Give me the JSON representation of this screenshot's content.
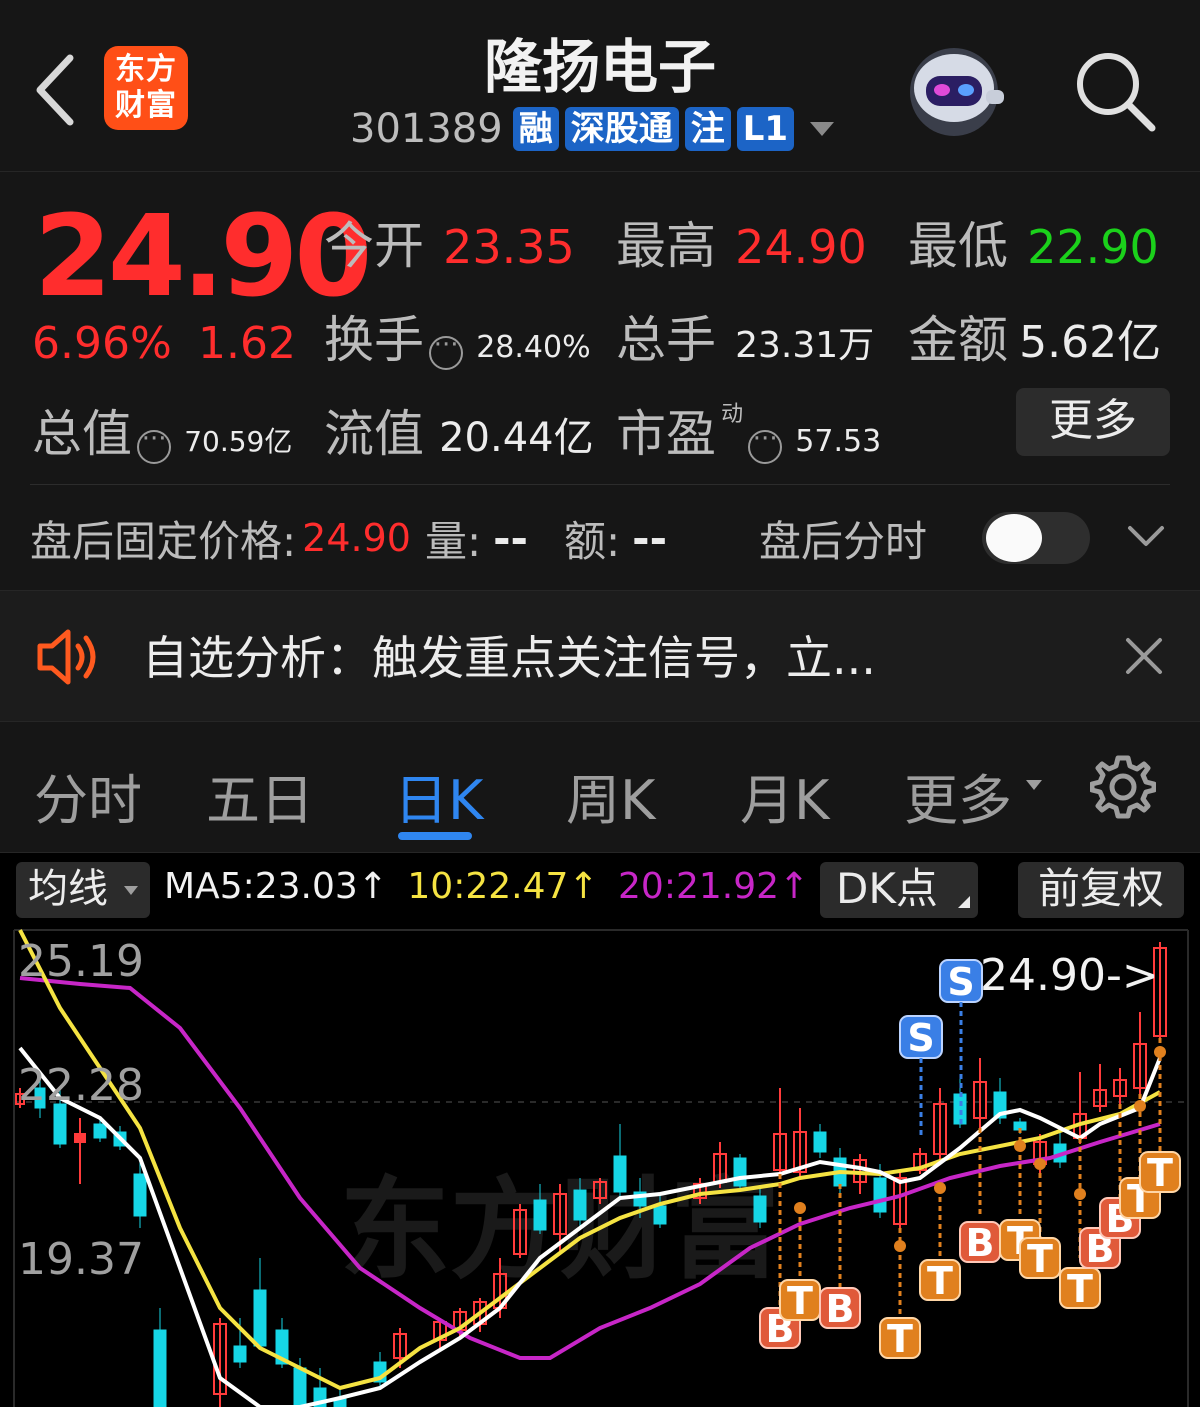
{
  "header": {
    "logo_line1": "东方",
    "logo_line2": "财富",
    "title": "隆扬电子",
    "code": "301389",
    "tags": [
      "融",
      "深股通",
      "注",
      "L1"
    ]
  },
  "quote": {
    "price": "24.90",
    "change_pct": "6.96%",
    "change_amt": "1.62",
    "open_label": "今开",
    "open": "23.35",
    "high_label": "最高",
    "high": "24.90",
    "low_label": "最低",
    "low": "22.90",
    "turnover_label": "换手",
    "turnover": "28.40%",
    "volume_label": "总手",
    "volume": "23.31万",
    "amount_label": "金额",
    "amount": "5.62亿",
    "mktcap_label": "总值",
    "mktcap": "70.59亿",
    "float_label": "流值",
    "float": "20.44亿",
    "pe_label": "市盈",
    "pe_sup": "动",
    "pe": "57.53",
    "more_label": "更多"
  },
  "after_hours": {
    "price_label": "盘后固定价格:",
    "price": "24.90",
    "vol_label": "量:",
    "vol": "--",
    "amt_label": "额:",
    "amt": "--",
    "intraday_label": "盘后分时"
  },
  "alert": {
    "text": "自选分析：触发重点关注信号，立..."
  },
  "tabs": [
    {
      "label": "分时"
    },
    {
      "label": "五日"
    },
    {
      "label": "日K",
      "active": true
    },
    {
      "label": "周K"
    },
    {
      "label": "月K"
    },
    {
      "label": "更多"
    }
  ],
  "chart_toolbar": {
    "ma_button": "均线",
    "ma5": "MA5:23.03↑",
    "ma10": "10:22.47↑",
    "ma20": "20:21.92↑",
    "dk_button": "DK点",
    "adjust_button": "前复权"
  },
  "colors": {
    "up": "#ff2d2d",
    "down": "#16d6e6",
    "ma5": "#ffffff",
    "ma10": "#f5e342",
    "ma20": "#c726c7",
    "accent": "#2f86f0"
  },
  "chart_data": {
    "type": "candlestick",
    "y_ticks": [
      "25.19",
      "22.28",
      "19.37"
    ],
    "last_price_label": "24.90->",
    "markers": [
      "S",
      "S",
      "B",
      "B",
      "T",
      "B",
      "T",
      "B",
      "T",
      "T",
      "T",
      "B",
      "B",
      "T",
      "T",
      "T"
    ]
  }
}
